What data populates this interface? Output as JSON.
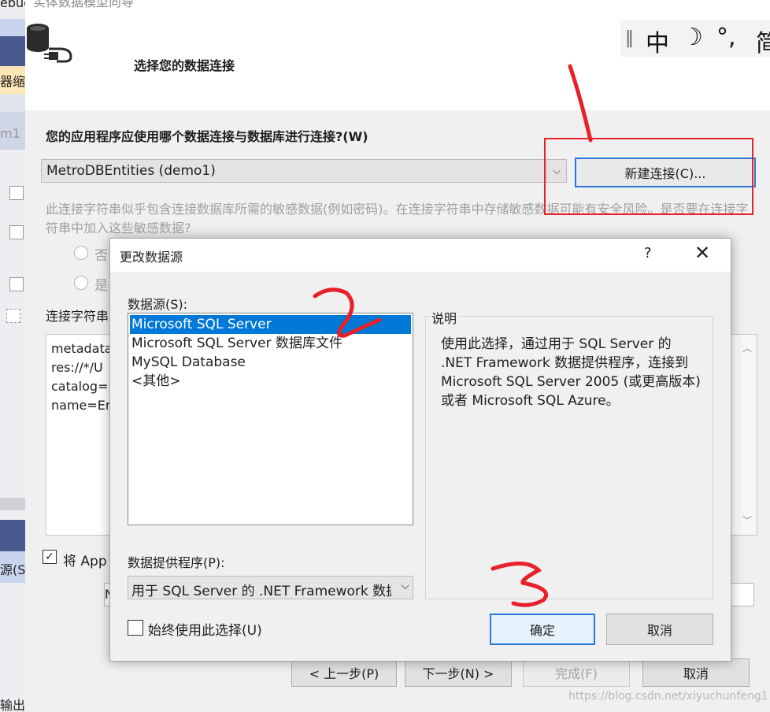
{
  "background_ide": {
    "title_fragment": "ebug",
    "zoom_fragment": "器缩",
    "project_fragment": "m1",
    "datasource_fragment": "源(S",
    "output_fragment": "输出"
  },
  "wizard": {
    "title": "实体数据模型向导",
    "heading": "选择您的数据连接",
    "ime_bar": {
      "mode": "中",
      "moon": "☽",
      "punct": "°,",
      "simp": "简"
    },
    "question": "您的应用程序应使用哪个数据连接与数据库进行连接?(W)",
    "connection_select": {
      "value": "MetroDBEntities (demo1)"
    },
    "new_connection_button": "新建连接(C)...",
    "sensitive_data_text": "此连接字符串似乎包含连接数据库所需的敏感数据(例如密码)。在连接字符串中存储敏感数据可能有安全风险。是否要在连接字符串中加入这些敏感数据?",
    "radio_no": "否",
    "radio_yes": "是",
    "connection_string_label": "连接字符串",
    "connection_string_lines": [
      "metadata",
      "res://*/U",
      "catalog=",
      "name=En"
    ],
    "save_checkbox_label": "将 App",
    "save_input_value": "N",
    "buttons": {
      "prev": "< 上一步(P)",
      "next": "下一步(N) >",
      "finish": "完成(F)",
      "cancel": "取消"
    },
    "watermark": "https://blog.csdn.net/xiyuchunfeng1"
  },
  "dialog": {
    "title": "更改数据源",
    "help": "?",
    "close": "✕",
    "datasource_label": "数据源(S):",
    "datasources": [
      {
        "label": "Microsoft SQL Server",
        "selected": true
      },
      {
        "label": "Microsoft SQL Server 数据库文件",
        "selected": false
      },
      {
        "label": "MySQL Database",
        "selected": false
      },
      {
        "label": "<其他>",
        "selected": false
      }
    ],
    "description_title": "说明",
    "description_text": "使用此选择，通过用于 SQL Server 的 .NET Framework 数据提供程序，连接到 Microsoft SQL Server 2005 (或更高版本)或者 Microsoft SQL Azure。",
    "provider_label": "数据提供程序(P):",
    "provider_value": "用于 SQL Server 的 .NET Framework 数据提供程序",
    "always_use_label": "始终使用此选择(U)",
    "ok_button": "确定",
    "cancel_button": "取消"
  },
  "annotations": {
    "step1": "1",
    "step2": "2",
    "step3": "3",
    "color": "#e8202a"
  },
  "colors": {
    "accent": "#0078d7",
    "focus_border": "#2a78d4"
  }
}
